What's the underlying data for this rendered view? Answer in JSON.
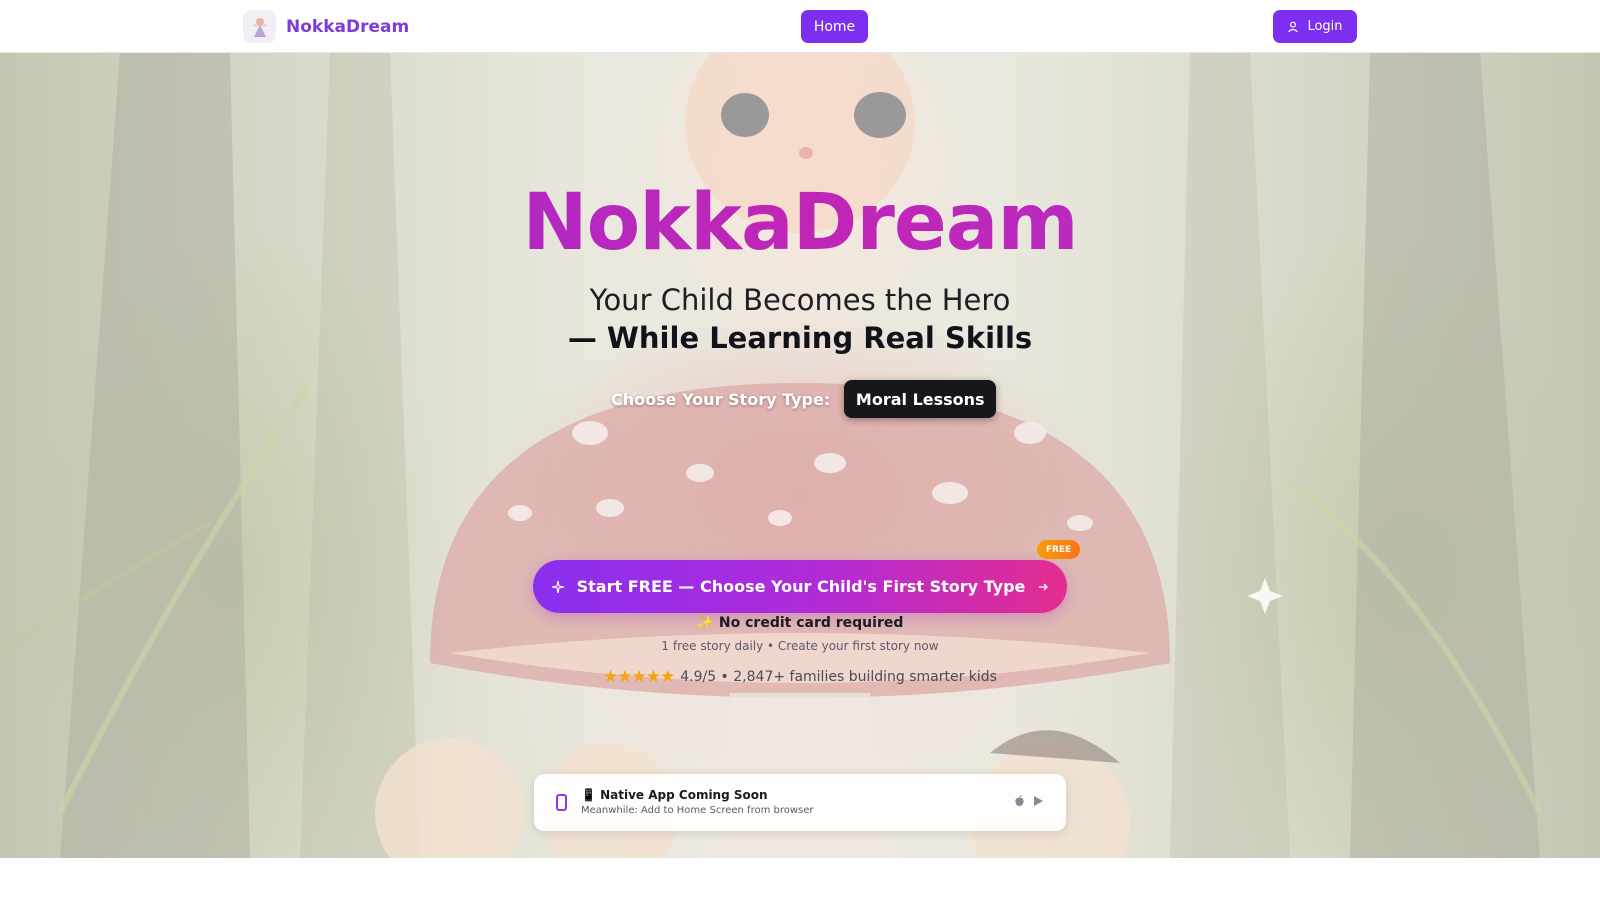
{
  "header": {
    "brand_name": "NokkaDream",
    "nav_home": "Home",
    "login_label": "Login"
  },
  "hero": {
    "title": "NokkaDream",
    "subtitle_line1": "Your Child Becomes the Hero",
    "subtitle_line2": "— While Learning Real Skills",
    "story_type_label": "Choose Your Story Type:",
    "story_type_value": "Moral Lessons",
    "cta_label": "Start FREE — Choose Your Child's First Story Type",
    "free_badge": "FREE",
    "no_credit_card": "✨ No credit card required",
    "free_daily": "1 free story daily • Create your first story now",
    "rating_stars": "★★★★★",
    "rating_text": "4.9/5 • 2,847+ families building smarter kids"
  },
  "app_notice": {
    "title": "📱 Native App Coming Soon",
    "subtitle": "Meanwhile: Add to Home Screen from browser",
    "icons": [
      "apple-icon",
      "play-store-icon"
    ]
  },
  "colors": {
    "accent": "#7c2ff0",
    "brand_text": "#7e3bd6",
    "cta_start": "#8a2ff0",
    "cta_end": "#e42d8e",
    "badge": "#f59e0b",
    "stars": "#f5a50b"
  }
}
